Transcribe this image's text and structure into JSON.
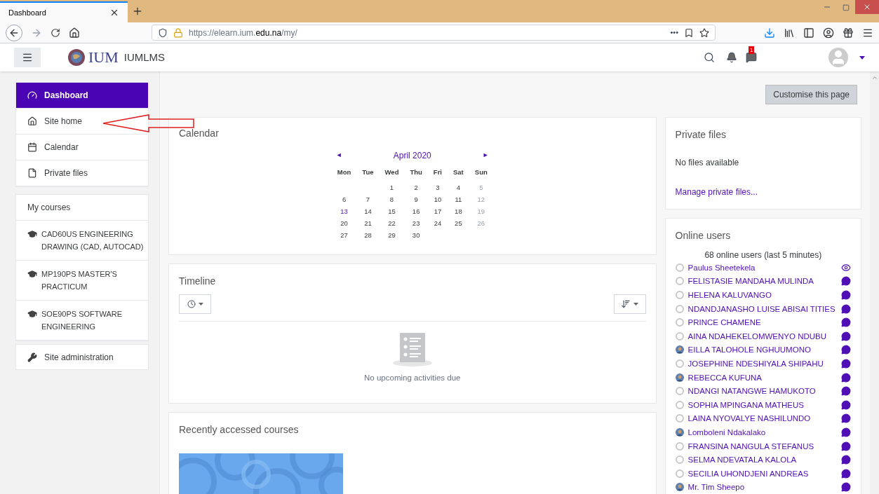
{
  "browser": {
    "tab_title": "Dashboard",
    "url_prefix": "https://elearn.ium.",
    "url_domain": "edu.na",
    "url_path": "/my/",
    "more": "•••"
  },
  "header": {
    "logo_text": "IUM",
    "site_name": "IUMLMS",
    "message_count": "1"
  },
  "sidebar": {
    "nav": [
      {
        "label": "Dashboard",
        "kind": "dashboard",
        "selected": true
      },
      {
        "label": "Site home",
        "kind": "home",
        "selected": false
      },
      {
        "label": "Calendar",
        "kind": "calendar",
        "selected": false
      },
      {
        "label": "Private files",
        "kind": "file",
        "selected": false
      }
    ],
    "courses_heading": "My courses",
    "courses": [
      "CAD60US ENGINEERING DRAWING (CAD, AUTOCAD)",
      "MP190PS MASTER'S PRACTICUM",
      "SOE90PS SOFTWARE ENGINEERING"
    ],
    "admin": "Site administration"
  },
  "customise_button": "Customise this page",
  "calendar": {
    "title": "Calendar",
    "prev": "◄",
    "month": "April 2020",
    "next": "►",
    "weekdays": [
      "Mon",
      "Tue",
      "Wed",
      "Thu",
      "Fri",
      "Sat",
      "Sun"
    ],
    "weeks": [
      {
        "kind": "end_aligned",
        "days": [
          {
            "day": "1",
            "today": false
          },
          {
            "day": "2",
            "today": false
          },
          {
            "day": "3",
            "today": false
          },
          {
            "day": "4",
            "today": false
          },
          {
            "day": "5",
            "today": false
          }
        ]
      },
      {
        "kind": "full",
        "days": [
          {
            "day": "6",
            "today": false
          },
          {
            "day": "7",
            "today": false
          },
          {
            "day": "8",
            "today": false
          },
          {
            "day": "9",
            "today": false
          },
          {
            "day": "10",
            "today": false
          },
          {
            "day": "11",
            "today": false
          },
          {
            "day": "12",
            "today": false
          }
        ]
      },
      {
        "kind": "full",
        "days": [
          {
            "day": "13",
            "today": true
          },
          {
            "day": "14",
            "today": false
          },
          {
            "day": "15",
            "today": false
          },
          {
            "day": "16",
            "today": false
          },
          {
            "day": "17",
            "today": false
          },
          {
            "day": "18",
            "today": false
          },
          {
            "day": "19",
            "today": false
          }
        ]
      },
      {
        "kind": "full",
        "days": [
          {
            "day": "20",
            "today": false
          },
          {
            "day": "21",
            "today": false
          },
          {
            "day": "22",
            "today": false
          },
          {
            "day": "23",
            "today": false
          },
          {
            "day": "24",
            "today": false
          },
          {
            "day": "25",
            "today": false
          },
          {
            "day": "26",
            "today": false
          }
        ]
      },
      {
        "kind": "start_aligned",
        "days": [
          {
            "day": "27",
            "today": false
          },
          {
            "day": "28",
            "today": false
          },
          {
            "day": "29",
            "today": false
          },
          {
            "day": "30",
            "today": false
          }
        ]
      }
    ]
  },
  "timeline": {
    "title": "Timeline",
    "empty_message": "No upcoming activities due"
  },
  "recent": {
    "title": "Recently accessed courses"
  },
  "private_files": {
    "title": "Private files",
    "empty_message": "No files available",
    "manage_link": "Manage private files..."
  },
  "online_users": {
    "title": "Online users",
    "summary": "68 online users (last 5 minutes)",
    "users": [
      {
        "name": "Paulus Sheetekela",
        "kind": "default",
        "self": true
      },
      {
        "name": "FELISTASIE MANDAHA MULINDA",
        "kind": "default",
        "self": false
      },
      {
        "name": "HELENA KALUVANGO",
        "kind": "default",
        "self": false
      },
      {
        "name": "NDANDJANASHO LUISE ABISAI TITIES",
        "kind": "default",
        "self": false
      },
      {
        "name": "PRINCE CHAMENE",
        "kind": "default",
        "self": false
      },
      {
        "name": "AINA NDAHEKELOMWENYO NDUBU",
        "kind": "default",
        "self": false
      },
      {
        "name": "EILLA TALOHOLE NGHUUMONO",
        "self": false
      },
      {
        "name": "JOSEPHINE NDESHIYALA SHIPAHU",
        "kind": "default",
        "self": false
      },
      {
        "name": "REBECCA KUFUNA",
        "self": false
      },
      {
        "name": "NDANGI NATANGWE HAMUKOTO",
        "kind": "default",
        "self": false
      },
      {
        "name": "SOPHIA MPINGANA MATHEUS",
        "kind": "default",
        "self": false
      },
      {
        "name": "LAINA NYOVALYE NASHILUNDO",
        "kind": "default",
        "self": false
      },
      {
        "name": "Lomboleni Ndakalako",
        "self": false
      },
      {
        "name": "FRANSINA NANGULA STEFANUS",
        "kind": "default",
        "self": false
      },
      {
        "name": "SELMA NDEVATALA KALOLA",
        "kind": "default",
        "self": false
      },
      {
        "name": "SECILIA UHONDJENI ANDREAS",
        "kind": "default",
        "self": false
      },
      {
        "name": "Mr. Tim Sheepo",
        "self": false
      }
    ]
  }
}
